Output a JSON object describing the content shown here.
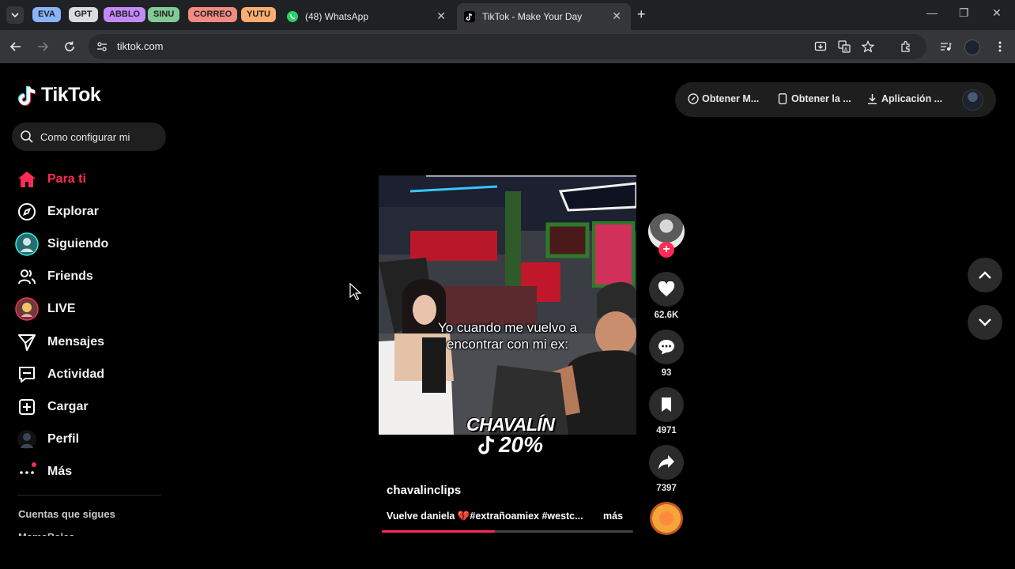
{
  "browser": {
    "tab_groups": [
      {
        "label": "EVA",
        "bg": "#8ab4f8",
        "fg": "#202124"
      },
      {
        "label": "GPT",
        "bg": "#dadce0",
        "fg": "#202124"
      },
      {
        "label": "ABBLO",
        "bg": "#c58af9",
        "fg": "#202124"
      },
      {
        "label": "SINU",
        "bg": "#81c995",
        "fg": "#202124"
      },
      {
        "label": "CORREO",
        "bg": "#f28b82",
        "fg": "#202124"
      },
      {
        "label": "YUTU",
        "bg": "#fcad70",
        "fg": "#202124"
      }
    ],
    "tabs": [
      {
        "title": "(48) WhatsApp",
        "icon": "whatsapp-icon"
      },
      {
        "title": "TikTok - Make Your Day",
        "icon": "tiktok-icon"
      }
    ],
    "url": "tiktok.com"
  },
  "tiktok": {
    "logo_text": "TikTok",
    "search_value": "Como configurar mi",
    "nav": [
      {
        "label": "Para ti",
        "icon": "home-icon",
        "active": true
      },
      {
        "label": "Explorar",
        "icon": "compass-icon"
      },
      {
        "label": "Siguiendo",
        "icon": "following-avatar-icon"
      },
      {
        "label": "Friends",
        "icon": "friends-icon"
      },
      {
        "label": "LIVE",
        "icon": "live-avatar-icon"
      },
      {
        "label": "Mensajes",
        "icon": "send-icon"
      },
      {
        "label": "Actividad",
        "icon": "activity-icon"
      },
      {
        "label": "Cargar",
        "icon": "upload-icon"
      },
      {
        "label": "Perfil",
        "icon": "profile-avatar-icon"
      },
      {
        "label": "Más",
        "icon": "more-icon"
      }
    ],
    "following_title": "Cuentas que sigues",
    "following_peek": "MamaBalas",
    "top_actions": [
      {
        "label": "Obtener M...",
        "icon": "coin-icon"
      },
      {
        "label": "Obtener la ...",
        "icon": "phone-icon"
      },
      {
        "label": "Aplicación ...",
        "icon": "download-icon"
      }
    ],
    "video": {
      "overlay_caption_line1": "Yo cuando me vuelvo a",
      "overlay_caption_line2": "encontrar con mi ex:",
      "brand_line1": "CHAVALÍN",
      "brand_line2": "20%",
      "author": "chavalinclips",
      "description": "Vuelve daniela 💔#extrañoamiex #westc...",
      "more_label": "más",
      "progress": 0.45
    },
    "actions": {
      "likes": "62.6K",
      "comments": "93",
      "saves": "4971",
      "shares": "7397"
    },
    "colors": {
      "accent": "#fe2c55"
    }
  }
}
